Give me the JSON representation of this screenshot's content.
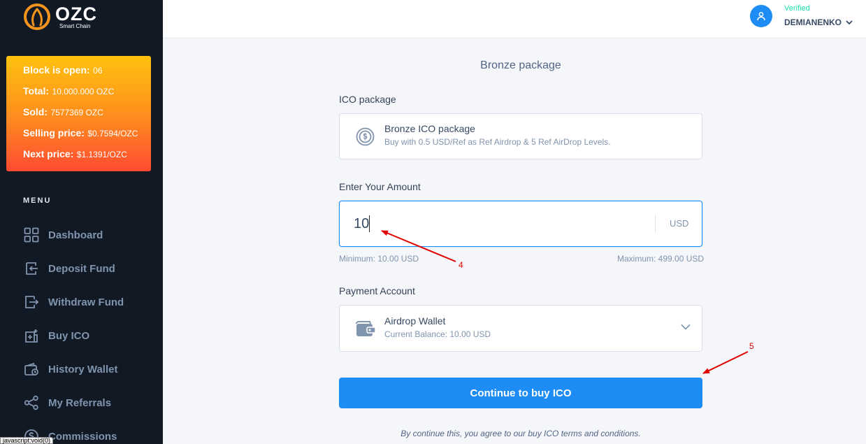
{
  "brand": {
    "name": "OZC",
    "tagline": "Smart Chain"
  },
  "block_info": [
    {
      "key": "Block is open:",
      "value": "06"
    },
    {
      "key": "Total:",
      "value": "10.000.000 OZC"
    },
    {
      "key": "Sold:",
      "value": "7577369 OZC"
    },
    {
      "key": "Selling price:",
      "value": "$0.7594/OZC"
    },
    {
      "key": "Next price:",
      "value": "$1.1391/OZC"
    }
  ],
  "menu": {
    "title": "MENU",
    "items": [
      {
        "label": "Dashboard",
        "icon": "dashboard-icon"
      },
      {
        "label": "Deposit Fund",
        "icon": "deposit-icon"
      },
      {
        "label": "Withdraw Fund",
        "icon": "withdraw-icon"
      },
      {
        "label": "Buy ICO",
        "icon": "buy-ico-icon"
      },
      {
        "label": "History Wallet",
        "icon": "wallet-history-icon"
      },
      {
        "label": "My Referrals",
        "icon": "referrals-icon"
      },
      {
        "label": "Commissions",
        "icon": "commissions-icon"
      }
    ]
  },
  "status_bar": "javascript:void(0)",
  "user": {
    "status": "Verified",
    "name": "DEMIANENKO"
  },
  "page": {
    "title": "Bronze package"
  },
  "ico_package": {
    "label": "ICO package",
    "name": "Bronze ICO package",
    "description": "Buy with 0.5 USD/Ref as Ref Airdrop & 5 Ref AirDrop Levels."
  },
  "amount": {
    "label": "Enter Your Amount",
    "value": "10",
    "unit": "USD",
    "minimum": "Minimum: 10.00 USD",
    "maximum": "Maximum: 499.00 USD"
  },
  "payment": {
    "label": "Payment Account",
    "wallet": "Airdrop Wallet",
    "balance": "Current Balance: 10.00 USD"
  },
  "cta_label": "Continue to buy ICO",
  "terms": "By continue this, you agree to our buy ICO terms and conditions.",
  "annotations": {
    "step4": "4",
    "step5": "5",
    "color": "#e00000"
  },
  "colors": {
    "accent": "#1e8cf5",
    "sidebar": "#101924",
    "verified": "#1ee0ac"
  }
}
